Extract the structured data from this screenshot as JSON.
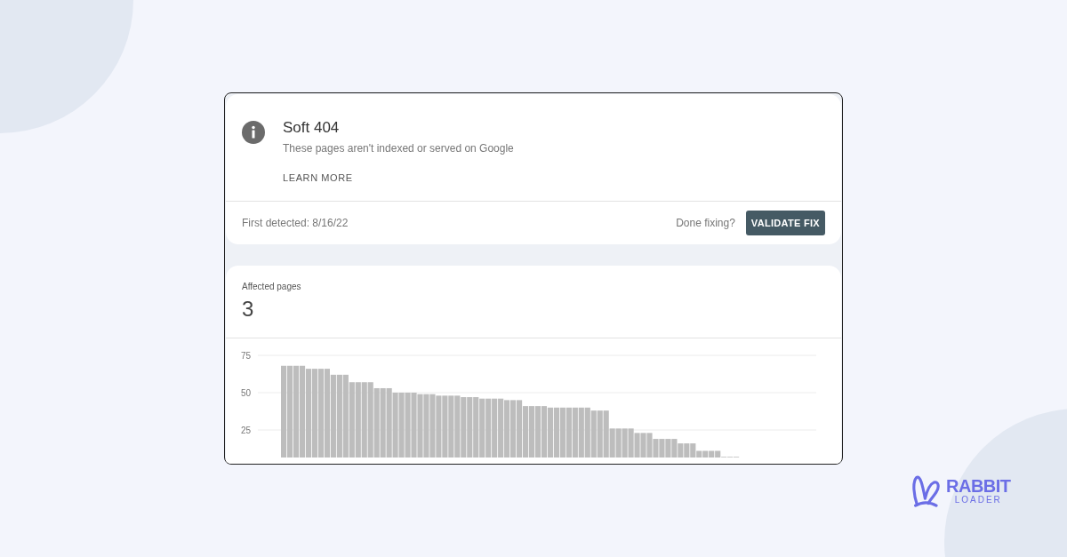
{
  "issue": {
    "title": "Soft 404",
    "description": "These pages aren't indexed or served on Google",
    "link": "LEARN MORE",
    "first_detected": "First detected: 8/16/22",
    "prompt": "Done fixing?",
    "button": "VALIDATE FIX"
  },
  "affected": {
    "label": "Affected pages",
    "count": "3",
    "chart_data": {
      "type": "bar",
      "ylim": [
        0,
        75
      ],
      "yticks": [
        25,
        50,
        75
      ],
      "series": [
        {
          "color": "#bdbdbd",
          "values": [
            68,
            68,
            68,
            68,
            66,
            66,
            66,
            66,
            62,
            62,
            62,
            57,
            57,
            57,
            57,
            53,
            53,
            53,
            50,
            50,
            50,
            50,
            49,
            49,
            49,
            48,
            48,
            48,
            48,
            47,
            47,
            47,
            46,
            46,
            46,
            46,
            45,
            45,
            45,
            41,
            41,
            41,
            41,
            40,
            40,
            40,
            40,
            40,
            40,
            40,
            38,
            38,
            38,
            26,
            26,
            26,
            26,
            23,
            23,
            23,
            19,
            19,
            19,
            19,
            16,
            16,
            16,
            11,
            11,
            11,
            11,
            7,
            7,
            7
          ]
        }
      ]
    }
  },
  "brand": {
    "name": "RABBIT",
    "tagline": "LOADER"
  }
}
